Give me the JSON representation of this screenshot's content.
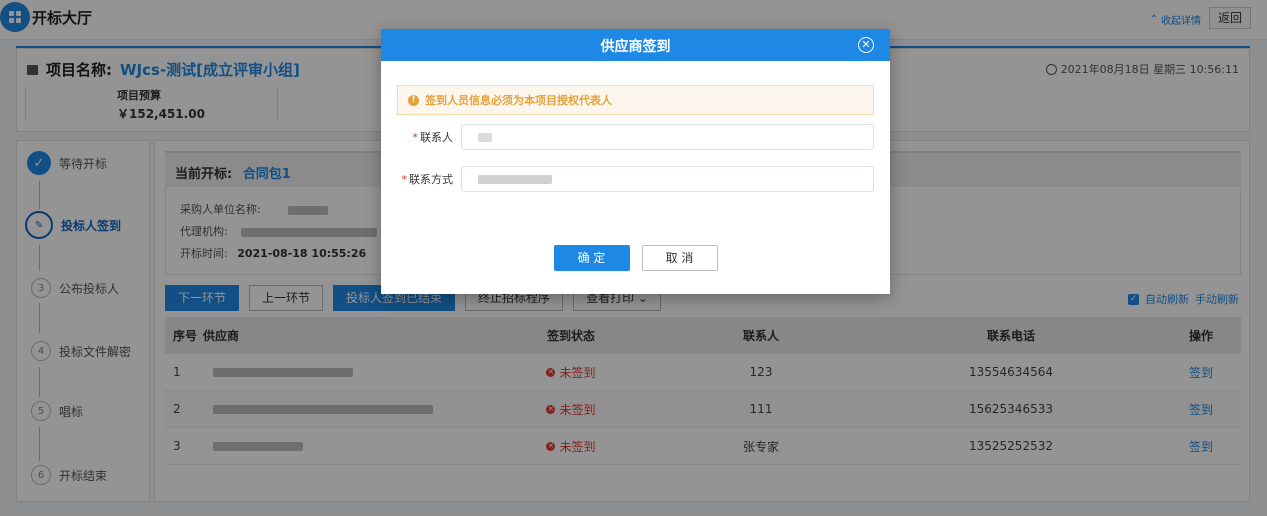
{
  "app": {
    "title": "开标大厅",
    "collapse_label": "收起详情",
    "back_label": "返回"
  },
  "project": {
    "name_label": "项目名称:",
    "name": "WJcs-测试[成立评审小组]",
    "budget_label": "项目预算",
    "budget_value": "￥152,451.00",
    "datetime": "2021年08月18日 星期三 10:56:11"
  },
  "steps": [
    {
      "num": "✓",
      "label": "等待开标",
      "state": "done"
    },
    {
      "num": "✎",
      "label": "投标人签到",
      "state": "active"
    },
    {
      "num": "3",
      "label": "公布投标人",
      "state": "todo"
    },
    {
      "num": "4",
      "label": "投标文件解密",
      "state": "todo"
    },
    {
      "num": "5",
      "label": "唱标",
      "state": "todo"
    },
    {
      "num": "6",
      "label": "开标结束",
      "state": "todo"
    }
  ],
  "current": {
    "label": "当前开标:",
    "package": "合同包1",
    "purchaser_label": "采购人单位名称:",
    "agency_label": "代理机构:",
    "open_time_label": "开标时间:",
    "open_time": "2021-08-18 10:55:26"
  },
  "actions": {
    "next": "下一环节",
    "prev": "上一环节",
    "signin_end": "投标人签到已结束",
    "stop": "终止招标程序",
    "print": "查看打印"
  },
  "refresh": {
    "auto": "自动刷新",
    "manual": "手动刷新"
  },
  "table": {
    "headers": {
      "seq": "序号",
      "supplier": "供应商",
      "status": "签到状态",
      "contact": "联系人",
      "phone": "联系电话",
      "op": "操作"
    },
    "rows": [
      {
        "seq": "1",
        "status": "未签到",
        "contact": "123",
        "phone": "13554634564",
        "op": "签到"
      },
      {
        "seq": "2",
        "status": "未签到",
        "contact": "111",
        "phone": "15625346533",
        "op": "签到"
      },
      {
        "seq": "3",
        "status": "未签到",
        "contact": "张专家",
        "phone": "13525252532",
        "op": "签到"
      }
    ]
  },
  "modal": {
    "title": "供应商签到",
    "notice": "签到人员信息必须为本项目授权代表人",
    "contact_label": "联系人",
    "phone_label": "联系方式",
    "confirm": "确 定",
    "cancel": "取 消"
  },
  "colors": {
    "accent": "#1e88e5",
    "danger": "#e53935",
    "warning": "#e6a23c"
  }
}
